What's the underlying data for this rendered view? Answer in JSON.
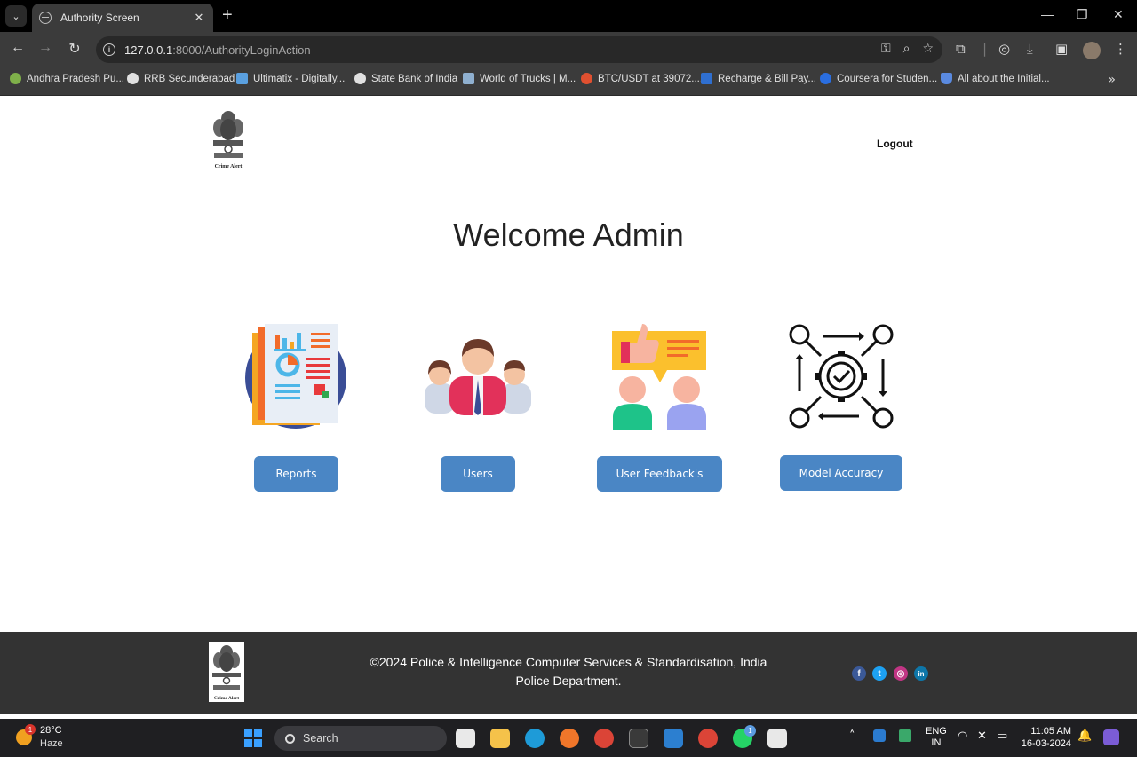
{
  "browser": {
    "tab_title": "Authority Screen",
    "url_host": "127.0.0.1",
    "url_rest": ":8000/AuthorityLoginAction",
    "bookmarks": [
      {
        "label": "Andhra Pradesh Pu...",
        "color": "#7fb04a"
      },
      {
        "label": "RRB Secunderabad",
        "color": "#e0e0e0"
      },
      {
        "label": "Ultimatix - Digitally...",
        "color": "#5aa0e0"
      },
      {
        "label": "State Bank of India",
        "color": "#e0e0e0"
      },
      {
        "label": "World of Trucks | M...",
        "color": "#8fb0d0"
      },
      {
        "label": "BTC/USDT at 39072....",
        "color": "#e05030"
      },
      {
        "label": "Recharge & Bill Pay...",
        "color": "#2f6fd0"
      },
      {
        "label": "Coursera for Studen...",
        "color": "#2a6ee0"
      },
      {
        "label": "All about the Initial...",
        "color": "#5a8ae0"
      }
    ]
  },
  "header": {
    "logo_caption": "Crime Alert",
    "logout_label": "Logout"
  },
  "main": {
    "welcome": "Welcome Admin",
    "cards": [
      {
        "label": "Reports",
        "icon": "reports-icon"
      },
      {
        "label": "Users",
        "icon": "users-icon"
      },
      {
        "label": "User Feedback's",
        "icon": "feedback-icon"
      },
      {
        "label": "Model Accuracy",
        "icon": "gear-check-icon"
      }
    ]
  },
  "footer": {
    "logo_caption": "Crime Alert",
    "text": "©2024 Police & Intelligence Computer Services & Standardisation, India Police Department.",
    "social": [
      {
        "name": "facebook-icon",
        "glyph": "f",
        "color": "#3b5998"
      },
      {
        "name": "twitter-icon",
        "glyph": "t",
        "color": "#1da1f2"
      },
      {
        "name": "instagram-icon",
        "glyph": "◎",
        "color": "#c13584"
      },
      {
        "name": "linkedin-icon",
        "glyph": "in",
        "color": "#0e76a8"
      }
    ]
  },
  "taskbar": {
    "weather_temp": "28°C",
    "weather_cond": "Haze",
    "weather_badge": "1",
    "search_label": "Search",
    "whatsapp_badge": "1",
    "lang_line1": "ENG",
    "lang_line2": "IN",
    "time": "11:05 AM",
    "date": "16-03-2024"
  }
}
